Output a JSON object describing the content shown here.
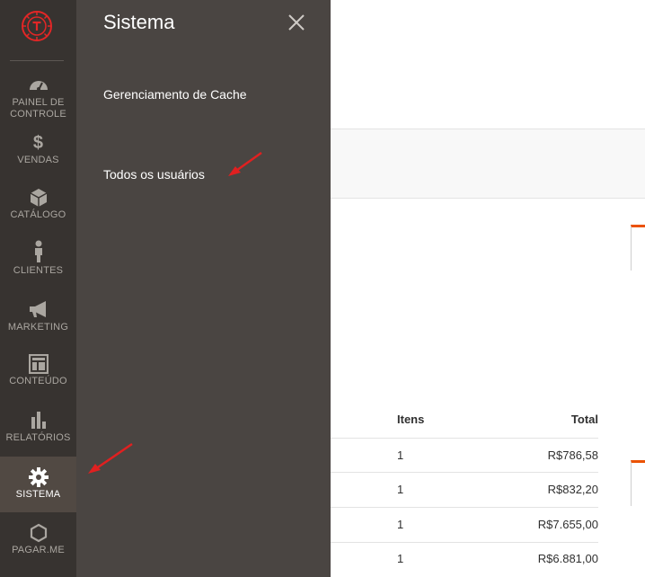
{
  "sidebar": {
    "items": [
      {
        "label": "PAINEL DE CONTROLE",
        "icon": "dashboard-icon"
      },
      {
        "label": "VENDAS",
        "icon": "dollar-icon"
      },
      {
        "label": "CATÁLOGO",
        "icon": "box-icon"
      },
      {
        "label": "CLIENTES",
        "icon": "person-icon"
      },
      {
        "label": "MARKETING",
        "icon": "megaphone-icon"
      },
      {
        "label": "CONTEÚDO",
        "icon": "layout-icon"
      },
      {
        "label": "RELATÓRIOS",
        "icon": "bar-chart-icon"
      },
      {
        "label": "SISTEMA",
        "icon": "gear-icon"
      },
      {
        "label": "PAGAR.ME",
        "icon": "hexagon-icon"
      }
    ],
    "active_item": "SISTEMA"
  },
  "panel": {
    "title": "Sistema",
    "links": [
      "Gerenciamento de Cache",
      "Todos os usuários"
    ]
  },
  "table": {
    "headers": {
      "items": "Itens",
      "total": "Total"
    },
    "rows": [
      {
        "items": "1",
        "total": "R$786,58"
      },
      {
        "items": "1",
        "total": "R$832,20"
      },
      {
        "items": "1",
        "total": "R$7.655,00"
      },
      {
        "items": "1",
        "total": "R$6.881,00"
      }
    ]
  },
  "colors": {
    "sidebar_bg": "#373330",
    "active_bg": "#514943",
    "panel_bg": "#4a4542",
    "accent": "#eb5202",
    "logo": "#e22626",
    "arrow": "#e02020"
  }
}
